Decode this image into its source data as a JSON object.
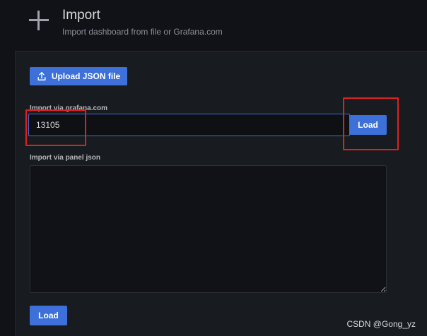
{
  "header": {
    "title": "Import",
    "subtitle": "Import dashboard from file or Grafana.com",
    "icon": "plus-icon"
  },
  "upload": {
    "label": "Upload JSON file",
    "icon": "upload-icon"
  },
  "grafana_import": {
    "label": "Import via grafana.com",
    "value": "13105",
    "load_label": "Load"
  },
  "panel_json": {
    "label": "Import via panel json",
    "value": "",
    "load_label": "Load"
  },
  "colors": {
    "background": "#111217",
    "panel": "#181b1f",
    "primary_button": "#3d71d9",
    "annotation": "#e02020"
  },
  "watermark": "CSDN @Gong_yz"
}
